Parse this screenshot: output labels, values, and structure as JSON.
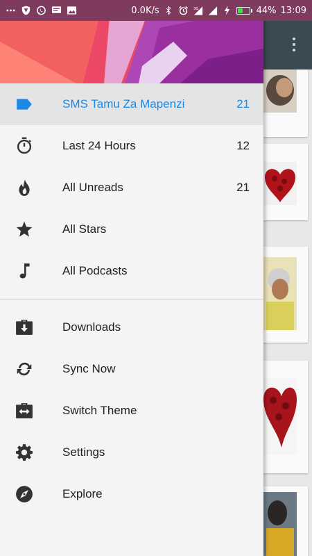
{
  "status_bar": {
    "net_speed": "0.0K/s",
    "battery": "44%",
    "battery_level": 0.44,
    "time": "13:09",
    "left_icons": [
      "more-icon",
      "shield-icon",
      "whatsapp-icon",
      "message-icon",
      "image-icon"
    ],
    "right_icons": [
      "bluetooth-icon",
      "alarm-icon",
      "signal-3g-icon",
      "signal-icon",
      "charging-icon"
    ]
  },
  "drawer": {
    "primary_items": [
      {
        "label": "SMS Tamu Za Mapenzi",
        "count": "21",
        "icon": "label-icon",
        "selected": true
      },
      {
        "label": "Last 24 Hours",
        "count": "12",
        "icon": "stopwatch-icon"
      },
      {
        "label": "All Unreads",
        "count": "21",
        "icon": "fire-icon"
      },
      {
        "label": "All Stars",
        "count": "",
        "icon": "star-icon"
      },
      {
        "label": "All Podcasts",
        "count": "",
        "icon": "music-note-icon"
      }
    ],
    "secondary_items": [
      {
        "label": "Downloads",
        "icon": "download-icon"
      },
      {
        "label": "Sync Now",
        "icon": "sync-icon"
      },
      {
        "label": "Switch Theme",
        "icon": "switch-theme-icon"
      },
      {
        "label": "Settings",
        "icon": "gear-icon"
      },
      {
        "label": "Explore",
        "icon": "compass-icon"
      }
    ]
  },
  "colors": {
    "accent": "#1e88e5",
    "status_bar": "#7e3b5e",
    "drawer_bg": "#f4f4f4",
    "selected_bg": "#e4e4e4"
  }
}
